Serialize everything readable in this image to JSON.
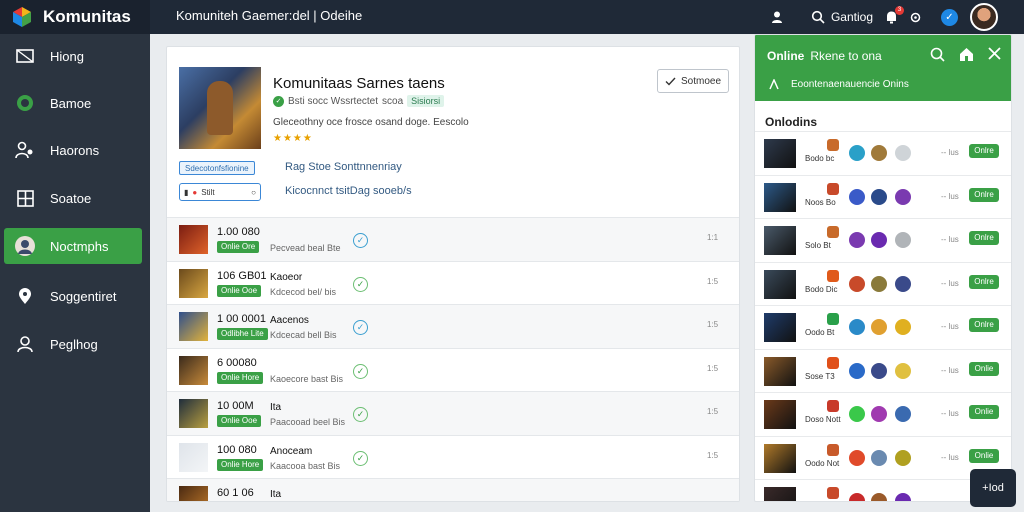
{
  "app": {
    "brand": "Komunitas",
    "window_title": "Komuniteh Gaemer:del | Odeihe"
  },
  "topbar": {
    "user_label": "Gantiog",
    "notif_count": "3"
  },
  "sidebar": {
    "items": [
      {
        "label": "Hiong",
        "icon": "send-icon"
      },
      {
        "label": "Bamoe",
        "icon": "gamepad-icon"
      },
      {
        "label": "Haorons",
        "icon": "users-icon"
      },
      {
        "label": "Soatoe",
        "icon": "grid-icon"
      },
      {
        "label": "Noctmphs",
        "icon": "avatar-icon",
        "active": true
      },
      {
        "label": "Soggentiret",
        "icon": "location-icon"
      },
      {
        "label": "Peglhog",
        "icon": "user-icon"
      }
    ]
  },
  "main": {
    "title": "Komunitaas Sarnes taens",
    "meta_text": "Bsti socc Wssrtectet",
    "meta_extra": "scoa",
    "meta_tag": "Sisiorsi",
    "description": "Gleceothny oce frosce osand doge. Eescolo",
    "stars": "★★★★",
    "action_label": "Sotmoee",
    "pill_tag": "Sdecotonfsfionine",
    "caption1": "Rag Stoe Sonttnnenriay",
    "control_value": "Stilt",
    "caption2": "Kicocnnct tsitDag sooeb/s",
    "rows": [
      {
        "value": "1.00 080",
        "badge": "Onlie Ore",
        "title": "",
        "sub": "Pecvead beal Bte",
        "check": "blue",
        "num": "1:1"
      },
      {
        "value": "106 GB01",
        "badge": "Onlie Ooe",
        "title": "Kaoeor",
        "sub": "Kdcecod bel/ bis",
        "check": "green",
        "num": "1:5"
      },
      {
        "value": "1 00 0001",
        "badge": "Odlibhe Lite",
        "title": "Aacenos",
        "sub": "Kdcecad bell Bis",
        "check": "blue",
        "num": "1:5"
      },
      {
        "value": "6 00080",
        "badge": "Onlie Hore",
        "title": "",
        "sub": "Kaoecore bast Bis",
        "check": "green",
        "num": "1:5"
      },
      {
        "value": "10 00M",
        "badge": "Onlie Ooe",
        "title": "Ita",
        "sub": "Paacooad beel Bis",
        "check": "green",
        "num": "1:5"
      },
      {
        "value": "100 080",
        "badge": "Onlie Hore",
        "title": "Anoceam",
        "sub": "Kaacooa bast Bis",
        "check": "green",
        "num": "1:5"
      },
      {
        "value": "60 1 06",
        "badge": "",
        "title": "Ita",
        "sub": "",
        "check": "",
        "num": ""
      }
    ]
  },
  "panel": {
    "title_bold": "Online",
    "title_rest": "Rkene to ona",
    "subtitle": "Eoontenaenauencie Onins",
    "section_title": "Onlodins",
    "rows": [
      {
        "label": "Bodo bc",
        "dash": "-- lus",
        "status": "Onlre"
      },
      {
        "label": "Noos Bo",
        "dash": "-- lus",
        "status": "Onlre"
      },
      {
        "label": "Solo Bt",
        "dash": "-- lus",
        "status": "Onlre"
      },
      {
        "label": "Bodo Dic",
        "dash": "-- lus",
        "status": "Onlre"
      },
      {
        "label": "Oodo Bt",
        "dash": "-- lus",
        "status": "Onlre"
      },
      {
        "label": "Sose T3",
        "dash": "-- lus",
        "status": "Onlie"
      },
      {
        "label": "Doso Nott",
        "dash": "-- lus",
        "status": "Onlie"
      },
      {
        "label": "Oodo Not",
        "dash": "-- lus",
        "status": "Onlie"
      },
      {
        "label": "",
        "dash": "",
        "status": ""
      }
    ]
  },
  "chat_button": {
    "label": "+Iod"
  }
}
